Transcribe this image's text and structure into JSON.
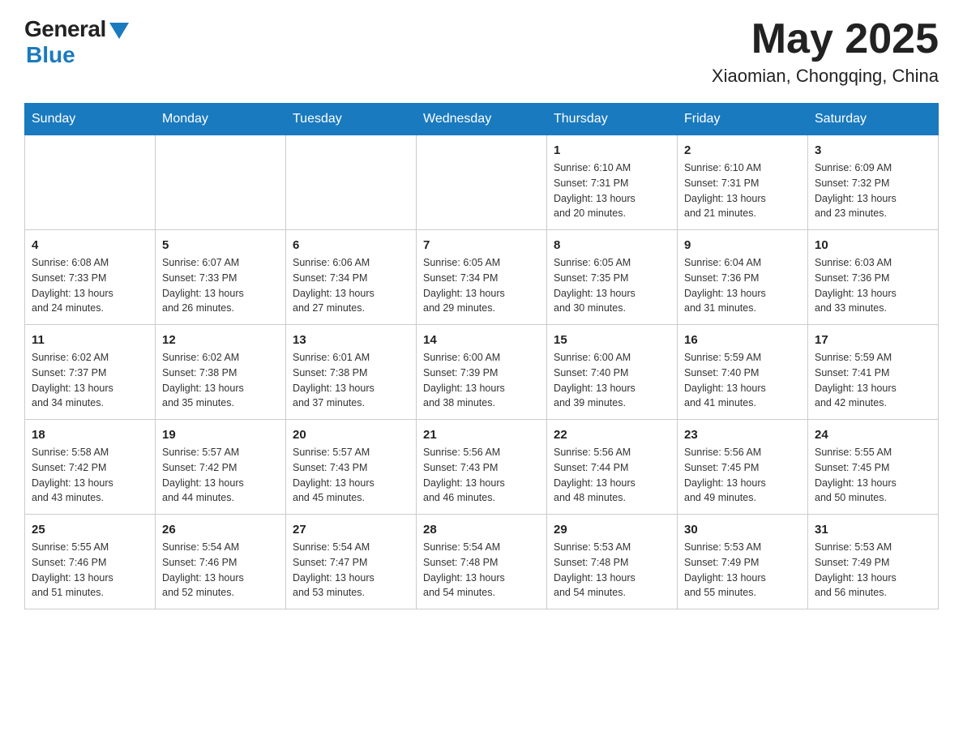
{
  "header": {
    "logo_general": "General",
    "logo_blue": "Blue",
    "month_year": "May 2025",
    "location": "Xiaomian, Chongqing, China"
  },
  "weekdays": [
    "Sunday",
    "Monday",
    "Tuesday",
    "Wednesday",
    "Thursday",
    "Friday",
    "Saturday"
  ],
  "weeks": [
    [
      {
        "day": "",
        "info": ""
      },
      {
        "day": "",
        "info": ""
      },
      {
        "day": "",
        "info": ""
      },
      {
        "day": "",
        "info": ""
      },
      {
        "day": "1",
        "info": "Sunrise: 6:10 AM\nSunset: 7:31 PM\nDaylight: 13 hours\nand 20 minutes."
      },
      {
        "day": "2",
        "info": "Sunrise: 6:10 AM\nSunset: 7:31 PM\nDaylight: 13 hours\nand 21 minutes."
      },
      {
        "day": "3",
        "info": "Sunrise: 6:09 AM\nSunset: 7:32 PM\nDaylight: 13 hours\nand 23 minutes."
      }
    ],
    [
      {
        "day": "4",
        "info": "Sunrise: 6:08 AM\nSunset: 7:33 PM\nDaylight: 13 hours\nand 24 minutes."
      },
      {
        "day": "5",
        "info": "Sunrise: 6:07 AM\nSunset: 7:33 PM\nDaylight: 13 hours\nand 26 minutes."
      },
      {
        "day": "6",
        "info": "Sunrise: 6:06 AM\nSunset: 7:34 PM\nDaylight: 13 hours\nand 27 minutes."
      },
      {
        "day": "7",
        "info": "Sunrise: 6:05 AM\nSunset: 7:34 PM\nDaylight: 13 hours\nand 29 minutes."
      },
      {
        "day": "8",
        "info": "Sunrise: 6:05 AM\nSunset: 7:35 PM\nDaylight: 13 hours\nand 30 minutes."
      },
      {
        "day": "9",
        "info": "Sunrise: 6:04 AM\nSunset: 7:36 PM\nDaylight: 13 hours\nand 31 minutes."
      },
      {
        "day": "10",
        "info": "Sunrise: 6:03 AM\nSunset: 7:36 PM\nDaylight: 13 hours\nand 33 minutes."
      }
    ],
    [
      {
        "day": "11",
        "info": "Sunrise: 6:02 AM\nSunset: 7:37 PM\nDaylight: 13 hours\nand 34 minutes."
      },
      {
        "day": "12",
        "info": "Sunrise: 6:02 AM\nSunset: 7:38 PM\nDaylight: 13 hours\nand 35 minutes."
      },
      {
        "day": "13",
        "info": "Sunrise: 6:01 AM\nSunset: 7:38 PM\nDaylight: 13 hours\nand 37 minutes."
      },
      {
        "day": "14",
        "info": "Sunrise: 6:00 AM\nSunset: 7:39 PM\nDaylight: 13 hours\nand 38 minutes."
      },
      {
        "day": "15",
        "info": "Sunrise: 6:00 AM\nSunset: 7:40 PM\nDaylight: 13 hours\nand 39 minutes."
      },
      {
        "day": "16",
        "info": "Sunrise: 5:59 AM\nSunset: 7:40 PM\nDaylight: 13 hours\nand 41 minutes."
      },
      {
        "day": "17",
        "info": "Sunrise: 5:59 AM\nSunset: 7:41 PM\nDaylight: 13 hours\nand 42 minutes."
      }
    ],
    [
      {
        "day": "18",
        "info": "Sunrise: 5:58 AM\nSunset: 7:42 PM\nDaylight: 13 hours\nand 43 minutes."
      },
      {
        "day": "19",
        "info": "Sunrise: 5:57 AM\nSunset: 7:42 PM\nDaylight: 13 hours\nand 44 minutes."
      },
      {
        "day": "20",
        "info": "Sunrise: 5:57 AM\nSunset: 7:43 PM\nDaylight: 13 hours\nand 45 minutes."
      },
      {
        "day": "21",
        "info": "Sunrise: 5:56 AM\nSunset: 7:43 PM\nDaylight: 13 hours\nand 46 minutes."
      },
      {
        "day": "22",
        "info": "Sunrise: 5:56 AM\nSunset: 7:44 PM\nDaylight: 13 hours\nand 48 minutes."
      },
      {
        "day": "23",
        "info": "Sunrise: 5:56 AM\nSunset: 7:45 PM\nDaylight: 13 hours\nand 49 minutes."
      },
      {
        "day": "24",
        "info": "Sunrise: 5:55 AM\nSunset: 7:45 PM\nDaylight: 13 hours\nand 50 minutes."
      }
    ],
    [
      {
        "day": "25",
        "info": "Sunrise: 5:55 AM\nSunset: 7:46 PM\nDaylight: 13 hours\nand 51 minutes."
      },
      {
        "day": "26",
        "info": "Sunrise: 5:54 AM\nSunset: 7:46 PM\nDaylight: 13 hours\nand 52 minutes."
      },
      {
        "day": "27",
        "info": "Sunrise: 5:54 AM\nSunset: 7:47 PM\nDaylight: 13 hours\nand 53 minutes."
      },
      {
        "day": "28",
        "info": "Sunrise: 5:54 AM\nSunset: 7:48 PM\nDaylight: 13 hours\nand 54 minutes."
      },
      {
        "day": "29",
        "info": "Sunrise: 5:53 AM\nSunset: 7:48 PM\nDaylight: 13 hours\nand 54 minutes."
      },
      {
        "day": "30",
        "info": "Sunrise: 5:53 AM\nSunset: 7:49 PM\nDaylight: 13 hours\nand 55 minutes."
      },
      {
        "day": "31",
        "info": "Sunrise: 5:53 AM\nSunset: 7:49 PM\nDaylight: 13 hours\nand 56 minutes."
      }
    ]
  ]
}
